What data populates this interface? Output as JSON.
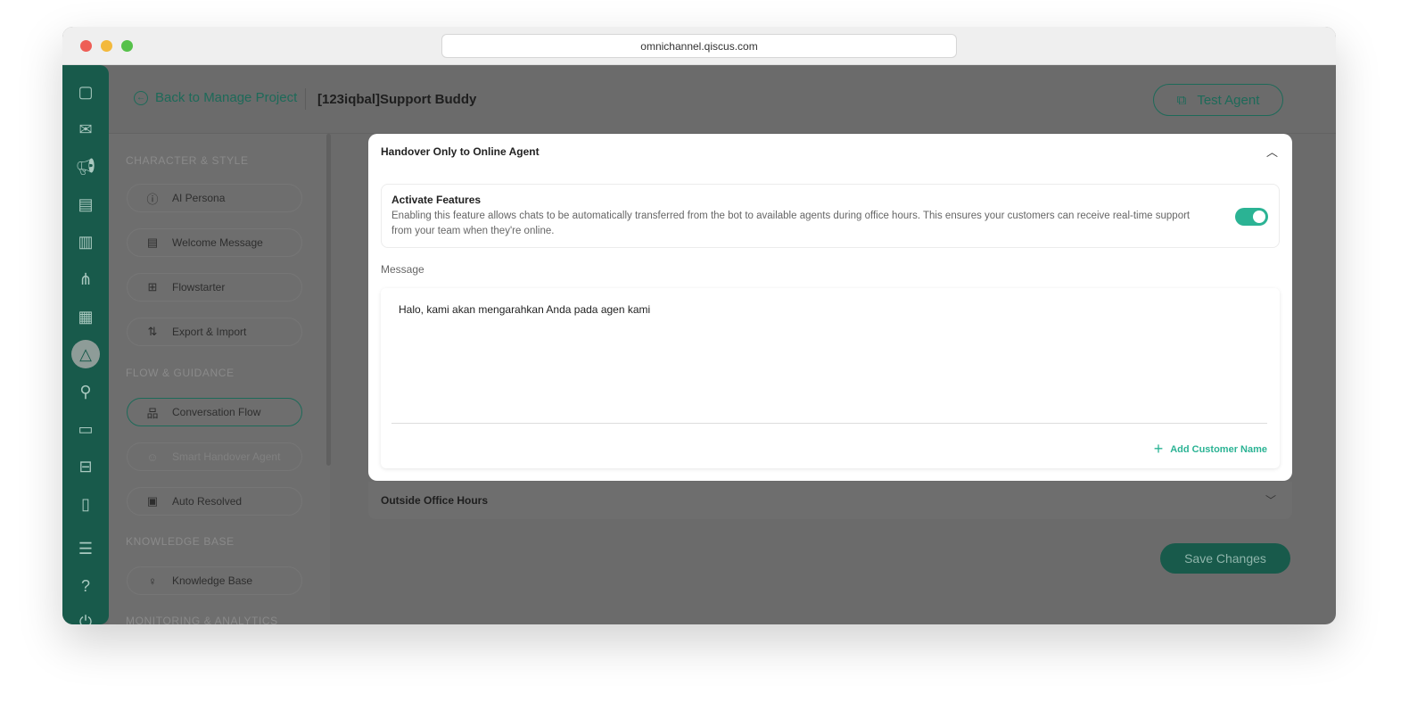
{
  "browser": {
    "url": "omnichannel.qiscus.com"
  },
  "header": {
    "back_label": "Back to Manage Project",
    "title": "[123iqbal]Support Buddy",
    "test_agent": "Test Agent"
  },
  "sidebar": {
    "sections": [
      "CHARACTER & STYLE",
      "FLOW & GUIDANCE",
      "KNOWLEDGE BASE",
      "MONITORING & ANALYTICS"
    ],
    "items": [
      {
        "label": "AI Persona",
        "icon": "info-icon"
      },
      {
        "label": "Welcome Message",
        "icon": "chat-icon"
      },
      {
        "label": "Flowstarter",
        "icon": "flow-icon"
      },
      {
        "label": "Export & Import",
        "icon": "arrows-icon"
      },
      {
        "label": "Conversation Flow",
        "icon": "hierarchy-icon"
      },
      {
        "label": "Smart Handover Agent",
        "icon": "user-check-icon"
      },
      {
        "label": "Auto Resolved",
        "icon": "chat-check-icon"
      },
      {
        "label": "Knowledge Base",
        "icon": "bulb-icon"
      }
    ]
  },
  "panel": {
    "title": "Handover Only to Online Agent",
    "feature_title": "Activate Features",
    "feature_desc": "Enabling this feature allows chats to be automatically transferred from the bot to available agents during office hours. This ensures your customers can receive real-time support from your team when they're online.",
    "feature_enabled": true,
    "message_label": "Message",
    "message_value": "Halo, kami akan mengarahkan Anda pada agen kami",
    "add_customer_name": "Add Customer Name"
  },
  "outside": {
    "title": "Outside Office Hours"
  },
  "save_label": "Save Changes",
  "colors": {
    "accent": "#2bb394",
    "rail": "#185a4b"
  }
}
